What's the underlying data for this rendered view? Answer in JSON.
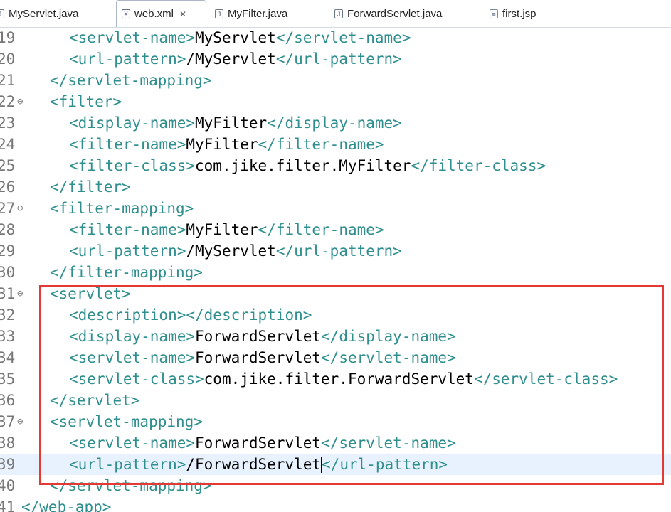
{
  "tabs": [
    {
      "label": "MyServlet.java",
      "icon": "java-file-icon",
      "active": false
    },
    {
      "label": "web.xml",
      "icon": "xml-file-icon",
      "active": true,
      "close": "✕"
    },
    {
      "label": "MyFilter.java",
      "icon": "java-file-icon",
      "active": false
    },
    {
      "label": "ForwardServlet.java",
      "icon": "java-file-icon",
      "active": false
    },
    {
      "label": "first.jsp",
      "icon": "jsp-file-icon",
      "active": false
    }
  ],
  "lines": [
    {
      "num": "19",
      "indent": 2,
      "open": "<servlet-name>",
      "text": "MyServlet",
      "close": "</servlet-name>"
    },
    {
      "num": "20",
      "indent": 2,
      "open": "<url-pattern>",
      "text": "/MyServlet",
      "close": "</url-pattern>"
    },
    {
      "num": "21",
      "indent": 1,
      "open": "</servlet-mapping>",
      "text": "",
      "close": ""
    },
    {
      "num": "22",
      "indent": 1,
      "open": "<filter>",
      "text": "",
      "close": "",
      "fold": true
    },
    {
      "num": "23",
      "indent": 2,
      "open": "<display-name>",
      "text": "MyFilter",
      "close": "</display-name>"
    },
    {
      "num": "24",
      "indent": 2,
      "open": "<filter-name>",
      "text": "MyFilter",
      "close": "</filter-name>"
    },
    {
      "num": "25",
      "indent": 2,
      "open": "<filter-class>",
      "text": "com.jike.filter.MyFilter",
      "close": "</filter-class>"
    },
    {
      "num": "26",
      "indent": 1,
      "open": "</filter>",
      "text": "",
      "close": ""
    },
    {
      "num": "27",
      "indent": 1,
      "open": "<filter-mapping>",
      "text": "",
      "close": "",
      "fold": true
    },
    {
      "num": "28",
      "indent": 2,
      "open": "<filter-name>",
      "text": "MyFilter",
      "close": "</filter-name>"
    },
    {
      "num": "29",
      "indent": 2,
      "open": "<url-pattern>",
      "text": "/MyServlet",
      "close": "</url-pattern>"
    },
    {
      "num": "30",
      "indent": 1,
      "open": "</filter-mapping>",
      "text": "",
      "close": ""
    },
    {
      "num": "31",
      "indent": 1,
      "open": "<servlet>",
      "text": "",
      "close": "",
      "fold": true
    },
    {
      "num": "32",
      "indent": 2,
      "open": "<description>",
      "text": "",
      "close": "</description>"
    },
    {
      "num": "33",
      "indent": 2,
      "open": "<display-name>",
      "text": "ForwardServlet",
      "close": "</display-name>"
    },
    {
      "num": "34",
      "indent": 2,
      "open": "<servlet-name>",
      "text": "ForwardServlet",
      "close": "</servlet-name>"
    },
    {
      "num": "35",
      "indent": 2,
      "open": "<servlet-class>",
      "text": "com.jike.filter.ForwardServlet",
      "close": "</servlet-class>"
    },
    {
      "num": "36",
      "indent": 1,
      "open": "</servlet>",
      "text": "",
      "close": ""
    },
    {
      "num": "37",
      "indent": 1,
      "open": "<servlet-mapping>",
      "text": "",
      "close": "",
      "fold": true
    },
    {
      "num": "38",
      "indent": 2,
      "open": "<servlet-name>",
      "text": "ForwardServlet",
      "close": "</servlet-name>"
    },
    {
      "num": "39",
      "indent": 2,
      "open": "<url-pattern>",
      "text": "/ForwardServlet",
      "close": "</url-pattern>",
      "current": true
    },
    {
      "num": "40",
      "indent": 1,
      "open": "</servlet-mapping>",
      "text": "",
      "close": ""
    },
    {
      "num": "41",
      "indent": 0,
      "open": "</web-app>",
      "text": "",
      "close": ""
    }
  ],
  "colors": {
    "tag": "#2f8f8f",
    "text": "#000000",
    "current_line": "#e8f2fe",
    "highlight_border": "#e53935"
  }
}
